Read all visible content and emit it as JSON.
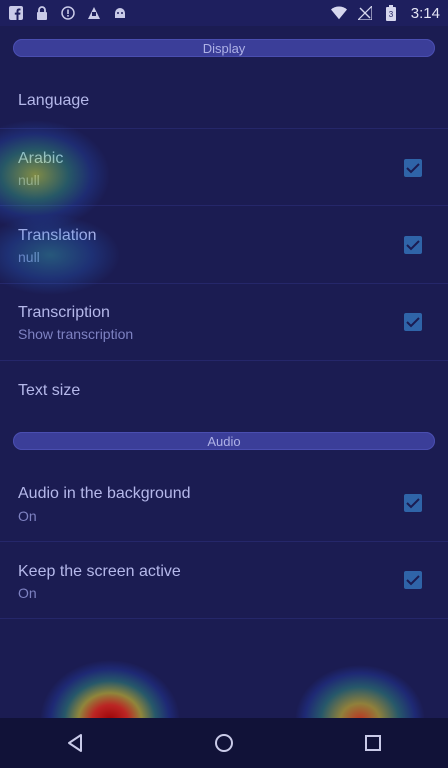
{
  "status_bar": {
    "time": "3:14",
    "left_icons": [
      "facebook-icon",
      "lock-icon",
      "alert-icon",
      "fake-gps-icon",
      "android-icon"
    ],
    "right_icons": [
      "wifi-icon",
      "no-signal-icon",
      "battery-icon"
    ],
    "battery_level": "3"
  },
  "sections": {
    "display": "Display",
    "audio": "Audio"
  },
  "prefs": {
    "language": {
      "title": "Language"
    },
    "arabic": {
      "title": "Arabic",
      "summary": "null",
      "checked": true
    },
    "translation": {
      "title": "Translation",
      "summary": "null",
      "checked": true
    },
    "transcription": {
      "title": "Transcription",
      "summary": "Show transcription",
      "checked": true
    },
    "text_size": {
      "title": "Text size"
    },
    "audio_background": {
      "title": "Audio in the background",
      "summary": "On",
      "checked": true
    },
    "keep_screen": {
      "title": "Keep the screen active",
      "summary": "On",
      "checked": true
    }
  },
  "nav": [
    "back-icon",
    "home-icon",
    "recents-icon"
  ],
  "colors": {
    "background": "#1b1c52",
    "header": "#3b3e99",
    "checkbox": "#2f64a8"
  }
}
